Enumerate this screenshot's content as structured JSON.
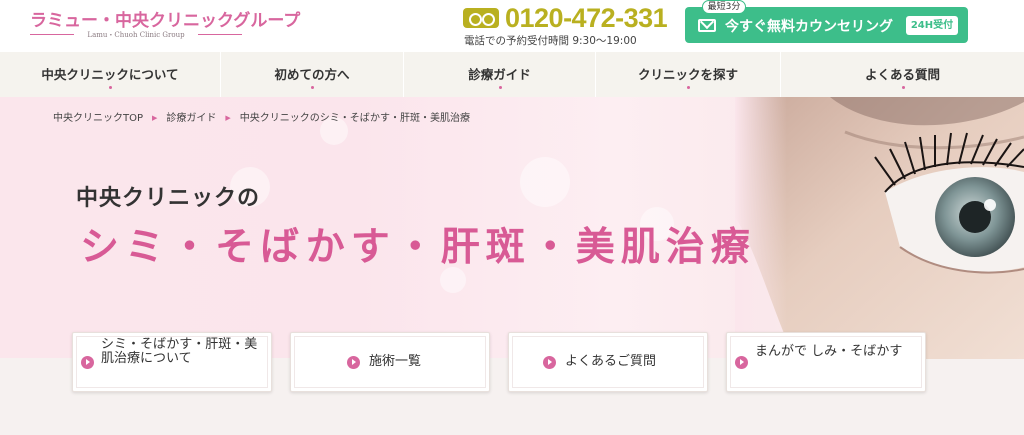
{
  "header": {
    "logo_title": "ラミュー・中央クリニックグループ",
    "logo_subtitle": "Lamu・Chuoh Clinic Group",
    "phone_icon": "free-dial-icon",
    "phone_number": "0120-472-331",
    "phone_hours": "電話での予約受付時間 9:30～19:00",
    "cta": {
      "tag": "最短3分",
      "icon": "mail-icon",
      "label": "今すぐ無料カウンセリング",
      "badge": "24H受付",
      "color": "#3dbe8a"
    }
  },
  "nav": {
    "items": [
      {
        "label": "中央クリニックについて"
      },
      {
        "label": "初めての方へ"
      },
      {
        "label": "診療ガイド"
      },
      {
        "label": "クリニックを探す"
      },
      {
        "label": "よくある質問"
      }
    ]
  },
  "breadcrumb": {
    "items": [
      "中央クリニックTOP",
      "診療ガイド",
      "中央クリニックのシミ・そばかす・肝斑・美肌治療"
    ]
  },
  "hero": {
    "subtitle": "中央クリニックの",
    "title": "シミ・そばかす・肝斑・美肌治療",
    "accent_color": "#d85a95"
  },
  "buttons": [
    {
      "label": "シミ・そばかす・肝斑・美肌治療について"
    },
    {
      "label": "施術一覧"
    },
    {
      "label": "よくあるご質問"
    },
    {
      "label": "まんがで しみ・そばかす"
    }
  ]
}
